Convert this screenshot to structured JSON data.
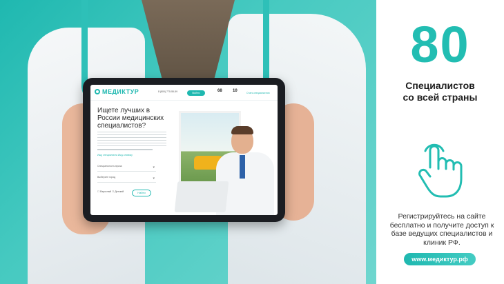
{
  "screen": {
    "logo": "МЕДИКТУР",
    "phone": "8 (800) 775-55-59",
    "header_button": "Войти",
    "stats": [
      {
        "value": "68"
      },
      {
        "value": "10"
      }
    ],
    "header_link": "Стать специалистом",
    "title": "Ищете лучших в России медицинских специалистов?",
    "tabs": "Ищу специалиста   Ищу клинику",
    "select_1": "Специальность врача",
    "select_2": "Выберите город",
    "checks": "☐ Взрослый  ☐ Детский",
    "find_button": "Найти"
  },
  "promo": {
    "big_number": "80",
    "subtitle_line1": "Специалистов",
    "subtitle_line2": "со всей страны",
    "description": "Регистрируйтесь на сайте бесплатно  и получите доступ к базе ведущих специалистов и клиник РФ.",
    "website": "www.медиктур.рф",
    "icon": "tap-hand-icon",
    "accent_color": "#22bdb2"
  }
}
